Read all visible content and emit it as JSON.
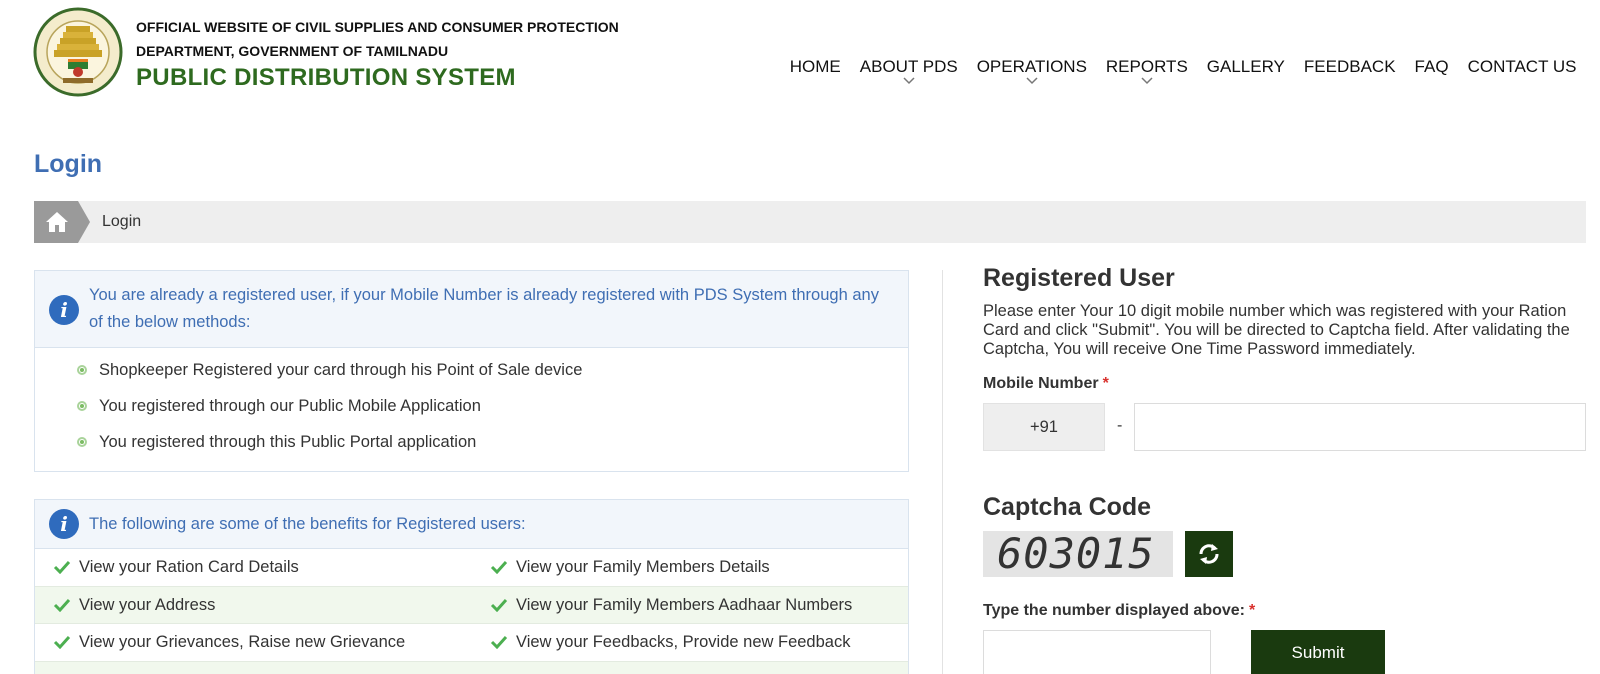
{
  "header": {
    "dept_line1": "OFFICIAL WEBSITE OF CIVIL SUPPLIES AND CONSUMER PROTECTION",
    "dept_line2": "DEPARTMENT, GOVERNMENT OF TAMILNADU",
    "site_name": "PUBLIC DISTRIBUTION SYSTEM",
    "emblem_icon": "tamilnadu-emblem-icon"
  },
  "nav": [
    {
      "label": "HOME",
      "has_dropdown": false
    },
    {
      "label": "ABOUT PDS",
      "has_dropdown": true
    },
    {
      "label": "OPERATIONS",
      "has_dropdown": true
    },
    {
      "label": "REPORTS",
      "has_dropdown": true
    },
    {
      "label": "GALLERY",
      "has_dropdown": false
    },
    {
      "label": "FEEDBACK",
      "has_dropdown": false
    },
    {
      "label": "FAQ",
      "has_dropdown": false
    },
    {
      "label": "CONTACT US",
      "has_dropdown": false
    }
  ],
  "page": {
    "title": "Login"
  },
  "breadcrumb": {
    "home_icon": "home-icon",
    "current": "Login"
  },
  "registered_info": {
    "heading": "You are already a registered user, if your Mobile Number is already registered with PDS System through any of the below methods:",
    "methods": [
      "Shopkeeper Registered your card through his Point of Sale device",
      "You registered through our Public Mobile Application",
      "You registered through this Public Portal application"
    ]
  },
  "benefits": {
    "heading": "The following are some of the benefits for Registered users:",
    "rows": [
      [
        "View your Ration Card Details",
        "View your Family Members Details"
      ],
      [
        "View your Address",
        "View your Family Members Aadhaar Numbers"
      ],
      [
        "View your Grievances, Raise new Grievance",
        "View your Feedbacks, Provide new Feedback"
      ]
    ]
  },
  "login_form": {
    "title": "Registered User",
    "description": "Please enter Your 10 digit mobile number which was registered with your Ration Card and click \"Submit\". You will be directed to Captcha field. After validating the Captcha, You will receive One Time Password immediately.",
    "mobile_label": "Mobile Number",
    "required_mark": "*",
    "country_code": "+91",
    "separator": "-",
    "mobile_value": "",
    "captcha_title": "Captcha Code",
    "captcha_text": "603015",
    "captcha_label": "Type the number displayed above:",
    "captcha_value": "",
    "submit_label": "Submit",
    "refresh_icon": "refresh-icon"
  },
  "colors": {
    "brand_green": "#2e6a1f",
    "title_blue": "#3f6eb3",
    "button_dark_green": "#1a3a0f",
    "required_red": "#d9312d"
  }
}
